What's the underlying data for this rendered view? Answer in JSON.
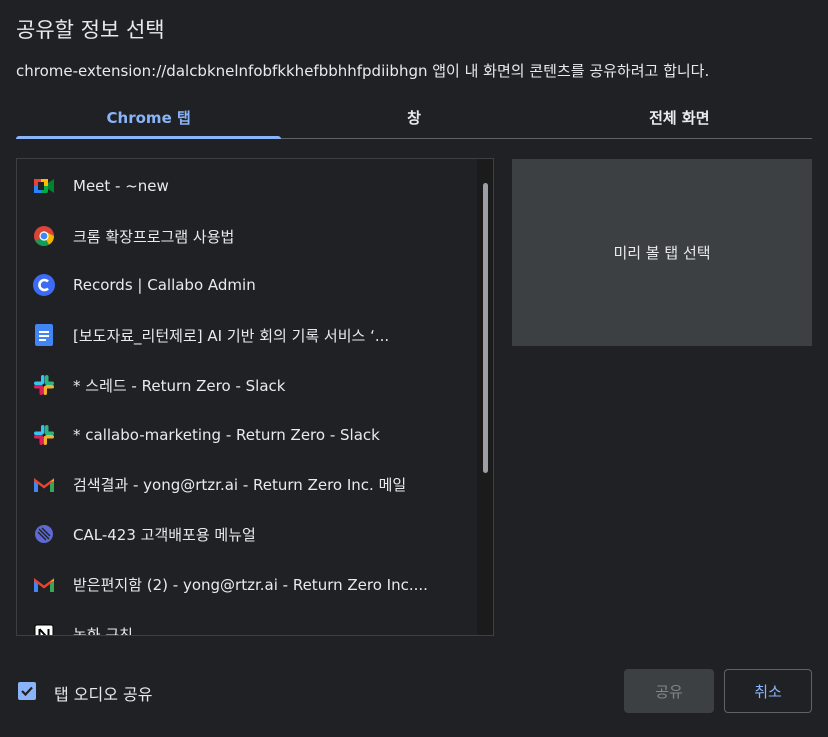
{
  "dialog": {
    "title": "공유할 정보 선택",
    "subtitle": "chrome-extension://dalcbknelnfobfkkhefbbhhfpdiibhgn 앱이 내 화면의 콘텐츠를 공유하려고 합니다."
  },
  "tabs": [
    {
      "label": "Chrome 탭",
      "active": true
    },
    {
      "label": "창",
      "active": false
    },
    {
      "label": "전체 화면",
      "active": false
    }
  ],
  "tab_list": [
    {
      "label": "Meet - ~new",
      "icon": "google-meet-icon"
    },
    {
      "label": "크롬 확장프로그램 사용법",
      "icon": "chrome-icon"
    },
    {
      "label": "Records | Callabo Admin",
      "icon": "callabo-icon"
    },
    {
      "label": "[보도자료_리턴제로] AI 기반 회의 기록 서비스 ‘...",
      "icon": "google-docs-icon"
    },
    {
      "label": "* 스레드 - Return Zero - Slack",
      "icon": "slack-icon"
    },
    {
      "label": "* callabo-marketing - Return Zero - Slack",
      "icon": "slack-icon"
    },
    {
      "label": "검색결과 - yong@rtzr.ai - Return Zero Inc. 메일",
      "icon": "gmail-icon"
    },
    {
      "label": "CAL-423 고객배포용 메뉴얼",
      "icon": "linear-icon"
    },
    {
      "label": "받은편지함 (2) - yong@rtzr.ai - Return Zero Inc....",
      "icon": "gmail-icon"
    },
    {
      "label": "녹화 규칙",
      "icon": "notion-icon"
    }
  ],
  "preview": {
    "text": "미리 볼 탭 선택"
  },
  "audio": {
    "label": "탭 오디오 공유",
    "checked": true
  },
  "buttons": {
    "share": "공유",
    "cancel": "취소"
  },
  "colors": {
    "background": "#202124",
    "accent": "#8ab4f8",
    "preview_bg": "#3c4043"
  }
}
